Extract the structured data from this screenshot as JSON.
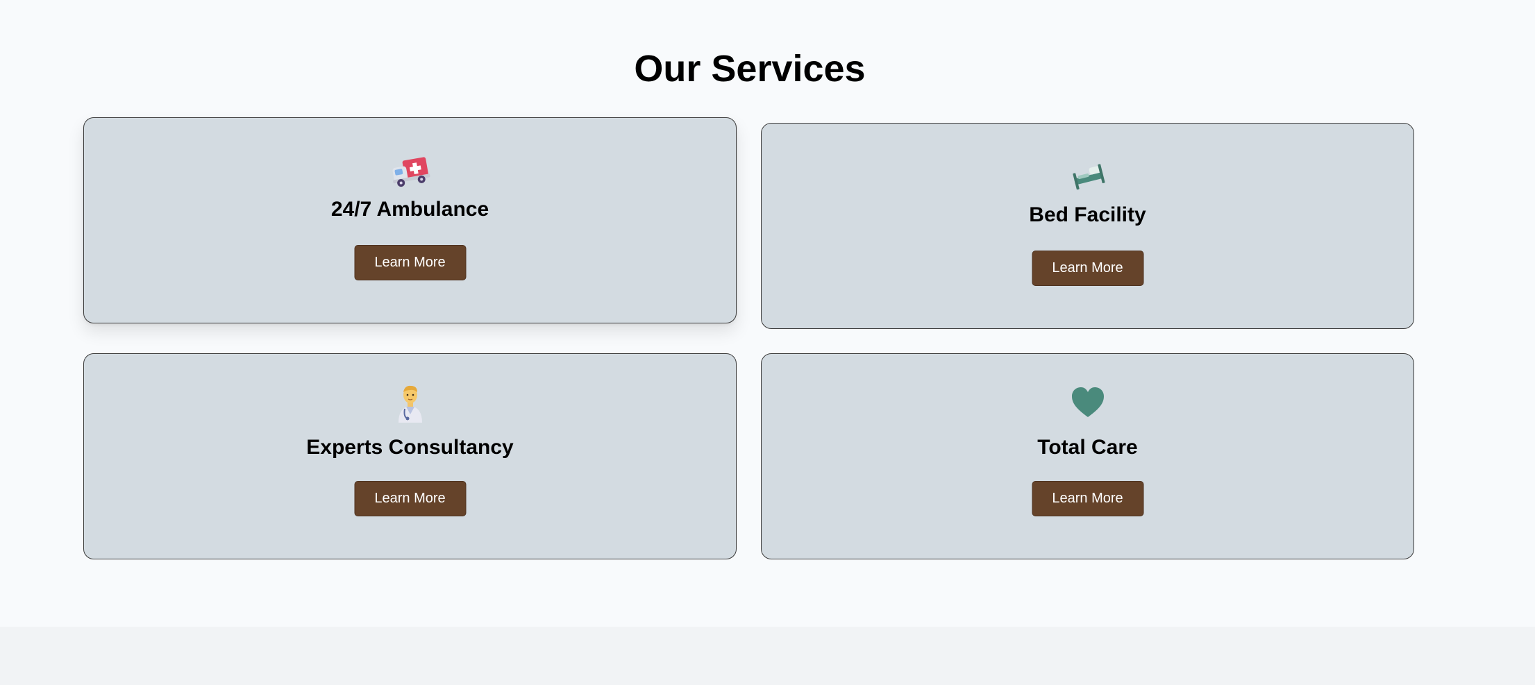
{
  "services_section": {
    "title": "Our Services",
    "cards": [
      {
        "icon": "ambulance-icon",
        "title": "24/7 Ambulance",
        "button_label": "Learn More"
      },
      {
        "icon": "bed-icon",
        "title": "Bed Facility",
        "button_label": "Learn More"
      },
      {
        "icon": "doctor-icon",
        "title": "Experts Consultancy",
        "button_label": "Learn More"
      },
      {
        "icon": "heart-icon",
        "title": "Total Care",
        "button_label": "Learn More"
      }
    ]
  },
  "colors": {
    "page_background": "#f8fafc",
    "card_background": "#d3dbe1",
    "button_background": "#65432a",
    "button_text": "#ffffff",
    "accent_teal": "#4a8a7c",
    "footer_band": "#f1f3f5"
  }
}
